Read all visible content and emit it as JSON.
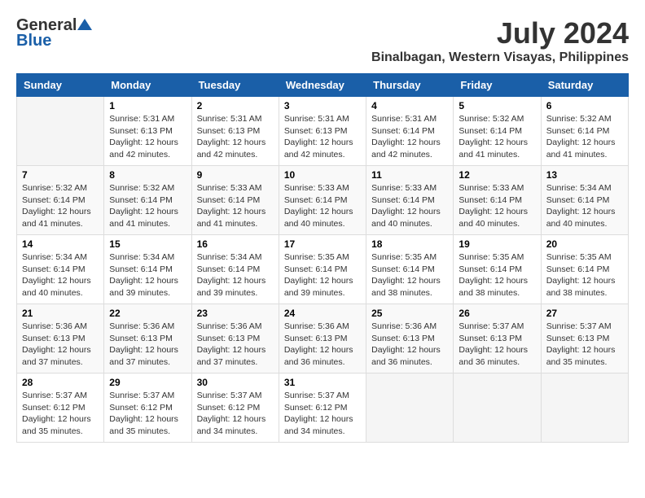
{
  "header": {
    "logo_general": "General",
    "logo_blue": "Blue",
    "month_year": "July 2024",
    "location": "Binalbagan, Western Visayas, Philippines"
  },
  "days_of_week": [
    "Sunday",
    "Monday",
    "Tuesday",
    "Wednesday",
    "Thursday",
    "Friday",
    "Saturday"
  ],
  "weeks": [
    [
      {
        "day": "",
        "info": ""
      },
      {
        "day": "1",
        "info": "Sunrise: 5:31 AM\nSunset: 6:13 PM\nDaylight: 12 hours\nand 42 minutes."
      },
      {
        "day": "2",
        "info": "Sunrise: 5:31 AM\nSunset: 6:13 PM\nDaylight: 12 hours\nand 42 minutes."
      },
      {
        "day": "3",
        "info": "Sunrise: 5:31 AM\nSunset: 6:13 PM\nDaylight: 12 hours\nand 42 minutes."
      },
      {
        "day": "4",
        "info": "Sunrise: 5:31 AM\nSunset: 6:14 PM\nDaylight: 12 hours\nand 42 minutes."
      },
      {
        "day": "5",
        "info": "Sunrise: 5:32 AM\nSunset: 6:14 PM\nDaylight: 12 hours\nand 41 minutes."
      },
      {
        "day": "6",
        "info": "Sunrise: 5:32 AM\nSunset: 6:14 PM\nDaylight: 12 hours\nand 41 minutes."
      }
    ],
    [
      {
        "day": "7",
        "info": "Sunrise: 5:32 AM\nSunset: 6:14 PM\nDaylight: 12 hours\nand 41 minutes."
      },
      {
        "day": "8",
        "info": "Sunrise: 5:32 AM\nSunset: 6:14 PM\nDaylight: 12 hours\nand 41 minutes."
      },
      {
        "day": "9",
        "info": "Sunrise: 5:33 AM\nSunset: 6:14 PM\nDaylight: 12 hours\nand 41 minutes."
      },
      {
        "day": "10",
        "info": "Sunrise: 5:33 AM\nSunset: 6:14 PM\nDaylight: 12 hours\nand 40 minutes."
      },
      {
        "day": "11",
        "info": "Sunrise: 5:33 AM\nSunset: 6:14 PM\nDaylight: 12 hours\nand 40 minutes."
      },
      {
        "day": "12",
        "info": "Sunrise: 5:33 AM\nSunset: 6:14 PM\nDaylight: 12 hours\nand 40 minutes."
      },
      {
        "day": "13",
        "info": "Sunrise: 5:34 AM\nSunset: 6:14 PM\nDaylight: 12 hours\nand 40 minutes."
      }
    ],
    [
      {
        "day": "14",
        "info": "Sunrise: 5:34 AM\nSunset: 6:14 PM\nDaylight: 12 hours\nand 40 minutes."
      },
      {
        "day": "15",
        "info": "Sunrise: 5:34 AM\nSunset: 6:14 PM\nDaylight: 12 hours\nand 39 minutes."
      },
      {
        "day": "16",
        "info": "Sunrise: 5:34 AM\nSunset: 6:14 PM\nDaylight: 12 hours\nand 39 minutes."
      },
      {
        "day": "17",
        "info": "Sunrise: 5:35 AM\nSunset: 6:14 PM\nDaylight: 12 hours\nand 39 minutes."
      },
      {
        "day": "18",
        "info": "Sunrise: 5:35 AM\nSunset: 6:14 PM\nDaylight: 12 hours\nand 38 minutes."
      },
      {
        "day": "19",
        "info": "Sunrise: 5:35 AM\nSunset: 6:14 PM\nDaylight: 12 hours\nand 38 minutes."
      },
      {
        "day": "20",
        "info": "Sunrise: 5:35 AM\nSunset: 6:14 PM\nDaylight: 12 hours\nand 38 minutes."
      }
    ],
    [
      {
        "day": "21",
        "info": "Sunrise: 5:36 AM\nSunset: 6:13 PM\nDaylight: 12 hours\nand 37 minutes."
      },
      {
        "day": "22",
        "info": "Sunrise: 5:36 AM\nSunset: 6:13 PM\nDaylight: 12 hours\nand 37 minutes."
      },
      {
        "day": "23",
        "info": "Sunrise: 5:36 AM\nSunset: 6:13 PM\nDaylight: 12 hours\nand 37 minutes."
      },
      {
        "day": "24",
        "info": "Sunrise: 5:36 AM\nSunset: 6:13 PM\nDaylight: 12 hours\nand 36 minutes."
      },
      {
        "day": "25",
        "info": "Sunrise: 5:36 AM\nSunset: 6:13 PM\nDaylight: 12 hours\nand 36 minutes."
      },
      {
        "day": "26",
        "info": "Sunrise: 5:37 AM\nSunset: 6:13 PM\nDaylight: 12 hours\nand 36 minutes."
      },
      {
        "day": "27",
        "info": "Sunrise: 5:37 AM\nSunset: 6:13 PM\nDaylight: 12 hours\nand 35 minutes."
      }
    ],
    [
      {
        "day": "28",
        "info": "Sunrise: 5:37 AM\nSunset: 6:12 PM\nDaylight: 12 hours\nand 35 minutes."
      },
      {
        "day": "29",
        "info": "Sunrise: 5:37 AM\nSunset: 6:12 PM\nDaylight: 12 hours\nand 35 minutes."
      },
      {
        "day": "30",
        "info": "Sunrise: 5:37 AM\nSunset: 6:12 PM\nDaylight: 12 hours\nand 34 minutes."
      },
      {
        "day": "31",
        "info": "Sunrise: 5:37 AM\nSunset: 6:12 PM\nDaylight: 12 hours\nand 34 minutes."
      },
      {
        "day": "",
        "info": ""
      },
      {
        "day": "",
        "info": ""
      },
      {
        "day": "",
        "info": ""
      }
    ]
  ]
}
